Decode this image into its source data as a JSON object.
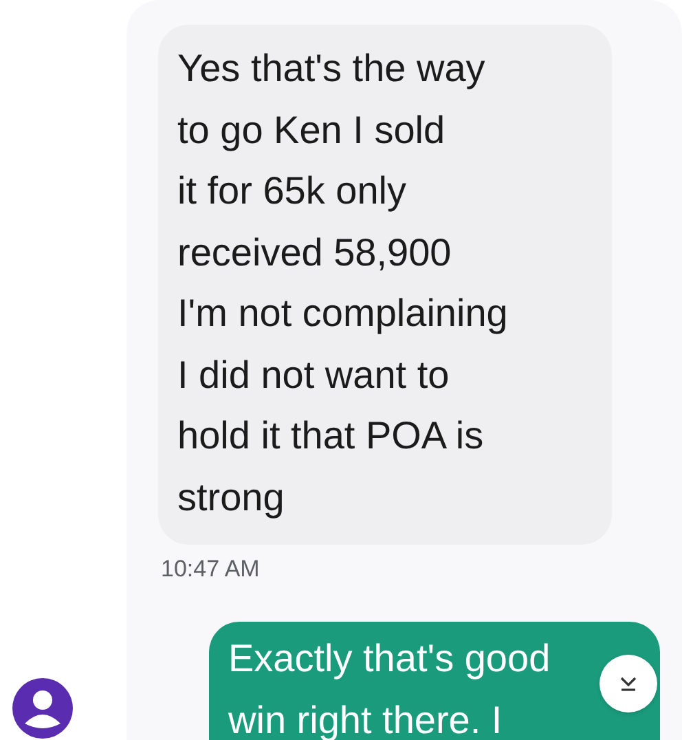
{
  "messages": [
    {
      "kind": "received",
      "text": "Yes that's the way\nto go Ken I sold\nit for 65k only\nreceived 58,900\nI'm not complaining\nI did not want to\nhold it that POA is\nstrong",
      "time": "10:47 AM"
    },
    {
      "kind": "sent",
      "text": "Exactly that's good\nwin right there. I"
    }
  ]
}
